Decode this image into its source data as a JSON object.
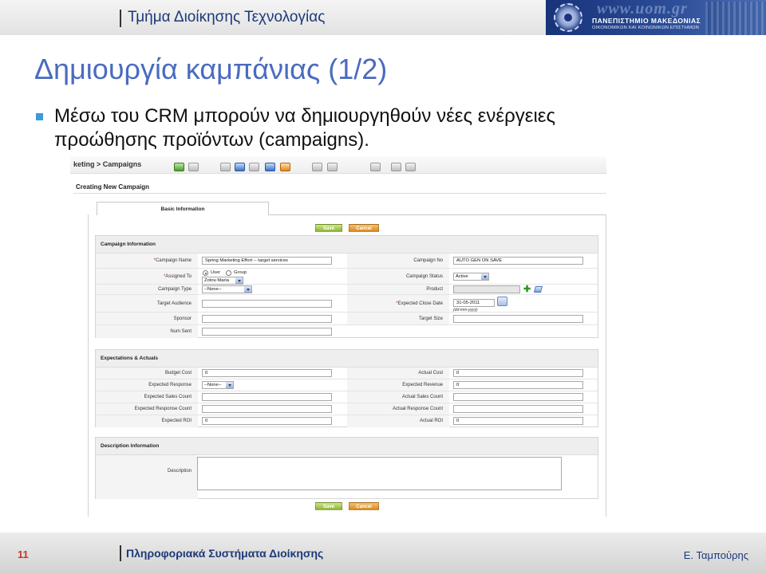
{
  "header": {
    "department": "Τμήμα Διοίκησης Τεχνολογίας",
    "university_url": "www.uom.gr",
    "university_name": "ΠΑΝΕΠΙΣΤΗΜΙΟ ΜΑΚΕΔΟΝΙΑΣ",
    "university_subtitle": "ΟΙΚΟΝΟΜΙΚΩΝ ΚΑΙ ΚΟΙΝΩΝΙΚΩΝ ΕΠΙΣΤΗΜΩΝ"
  },
  "slide": {
    "title": "Δημιουργία καμπάνιας (1/2)",
    "bullet": "Μέσω του CRM μπορούν να δημιουργηθούν νέες ενέργειες προώθησης προϊόντων (campaigns)."
  },
  "crm": {
    "breadcrumb": "keting > Campaigns",
    "page_heading": "Creating New Campaign",
    "tab_basic": "Basic Information",
    "save_label": "Save",
    "cancel_label": "Cancel",
    "campaign_info": {
      "title": "Campaign Information",
      "name_label": "Campaign Name",
      "name_value": "Spring Marketing Effort -- target services",
      "no_label": "Campaign No",
      "no_value": "AUTO GEN ON SAVE",
      "assigned_label": "Assigned To",
      "user_option": "User",
      "group_option": "Group",
      "assigned_value": "Zotou Maria",
      "status_label": "Campaign Status",
      "status_value": "Active",
      "type_label": "Campaign Type",
      "type_value": "--None--",
      "product_label": "Product",
      "audience_label": "Target Audience",
      "close_date_label": "Expected Close Date",
      "close_date_value": "31-05-2011",
      "date_format": "(dd-mm-yyyy)",
      "sponsor_label": "Sponsor",
      "target_size_label": "Target Size",
      "num_sent_label": "Num Sent"
    },
    "expectations": {
      "title": "Expectations & Actuals",
      "budget_label": "Budget Cost",
      "budget_value": "0",
      "actual_cost_label": "Actual Cost",
      "actual_cost_value": "0",
      "exp_response_label": "Expected Response",
      "exp_response_value": "--None--",
      "exp_revenue_label": "Expected Revenue",
      "exp_revenue_value": "0",
      "exp_sales_label": "Expected Sales Count",
      "act_sales_label": "Actual Sales Count",
      "exp_resp_count_label": "Expected Response Count",
      "act_resp_count_label": "Actual Response Count",
      "exp_roi_label": "Expected ROI",
      "exp_roi_value": "0",
      "act_roi_label": "Actual ROI",
      "act_roi_value": "0"
    },
    "description": {
      "title": "Description Information",
      "label": "Description"
    }
  },
  "footer": {
    "page_number": "11",
    "course": "Πληροφοριακά Συστήματα Διοίκησης",
    "author": "Ε. Ταμπούρης"
  },
  "colors": {
    "title": "#4a6bbf",
    "bullet": "#3d9bd6",
    "page_number": "#c0392b",
    "navy": "#1b3a78",
    "save": "#8db634",
    "cancel": "#db8a1c"
  }
}
